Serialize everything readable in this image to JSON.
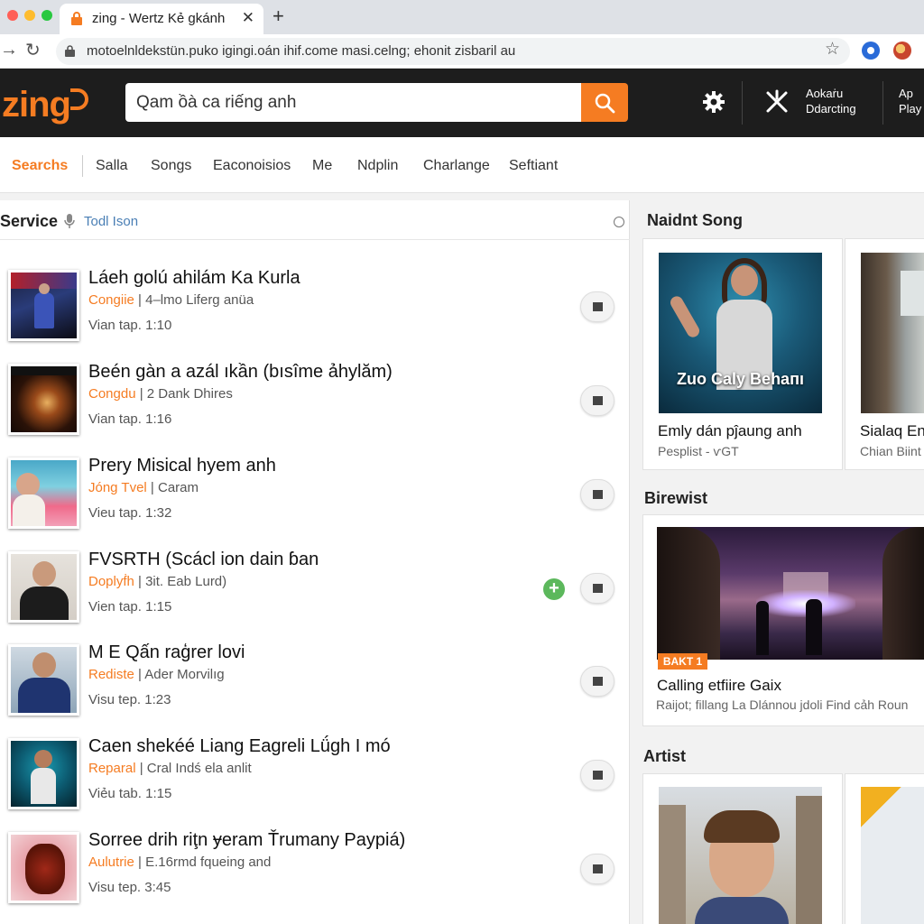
{
  "browser": {
    "tab_title": "zing - Wertz Kẻ gkánh",
    "tab_close": "✕",
    "new_tab": "+",
    "url": "motoelnldekstün.puko igingi.oán ihif.come masi.celng; ehonit zisbaril au",
    "bookmark_icon": "star-icon",
    "back_glyph": "→",
    "reload_glyph": "↻",
    "star_glyph": "☆"
  },
  "header": {
    "logo": "zing",
    "search_value": "Qam ồà ca riếng anh",
    "download_label_1": "Aokaṙu",
    "download_label_2": "Ddarcting",
    "app_label_1": "Ap",
    "app_label_2": "Play"
  },
  "nav": {
    "items": [
      "Searchs",
      "Salla",
      "Songs",
      "Eaconoisios",
      "Me",
      "Ndplin",
      "Charlange",
      "Seftiant"
    ]
  },
  "left_panel": {
    "title": "Service",
    "subtitle": "Todl Ison",
    "songs": [
      {
        "title": "Láеh golú ahilám Ka Kurla",
        "artist": "Congiie",
        "rest": "4–lmo Liferg anüa",
        "views": "Vian tap. 1:10"
      },
      {
        "title": "Beén gàn a azál ıkần (bısîme ảhylăm)",
        "artist": "Congdu",
        "rest": "2 Dank Dhires",
        "views": "Vian tap. 1:16"
      },
      {
        "title": "Prery Misical hyem anh",
        "artist": "Jóng Tvel",
        "rest": "Caram",
        "views": "Vieu tap. 1:32"
      },
      {
        "title": "FVSRTH (Scácl ion dain ɓan",
        "artist": "Doplyḟh",
        "rest": "3it. Eab Lurd)",
        "views": "Vien tap. 1:15"
      },
      {
        "title": "M E Qấn raģrer lovi",
        "artist": "Rediste",
        "rest": "Ader Morvilıg",
        "views": "Visu tep. 1:23"
      },
      {
        "title": "Caen shekéé Liang Eagreli Lǘgh I mó",
        "artist": "Reparal",
        "rest": "Cral Indś ela anlit",
        "views": "Viẻu tab. 1:15"
      },
      {
        "title": "Sorree drih riţn ɏeram Ťrumany Paypiá)",
        "artist": "Aulutrie",
        "rest": "E.16rmd fqueing and",
        "views": "Visu tep. 3:45"
      }
    ]
  },
  "right_panel": {
    "section1_title": "Naidnt Song",
    "card1": {
      "overlay": "Zuo Caly Behaпı",
      "title": "Emly dán pĵaung anh",
      "sub": "Pesplist - ѵGT"
    },
    "card2": {
      "title": "Sialaq En",
      "sub": "Chian Biint"
    },
    "section2_title": "Birewist",
    "card3": {
      "badge": "BAKT 1",
      "title": "Calling etfiire Gaix",
      "sub": "Raijot; fillang La Dlánnou jdoli Find cảh Roun"
    },
    "section3_title": "Artist"
  },
  "colors": {
    "accent": "#f57c22",
    "header_bg": "#1d1d1d"
  }
}
